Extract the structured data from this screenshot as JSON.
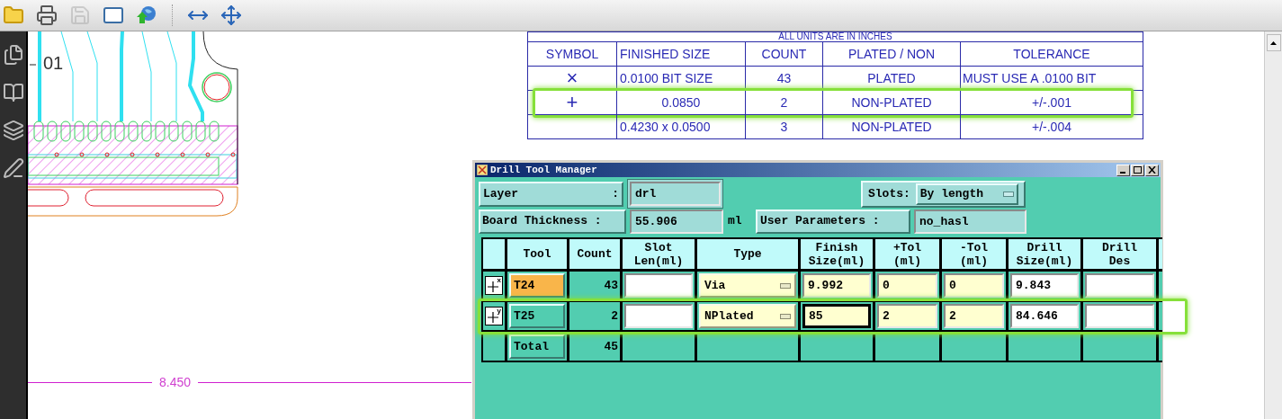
{
  "toolbar": {
    "buttons": [
      {
        "disabled": false
      },
      {
        "disabled": false
      },
      {
        "disabled": true
      },
      {
        "disabled": false
      },
      {
        "disabled": false
      },
      {
        "disabled": false
      },
      {
        "disabled": false
      }
    ]
  },
  "document": {
    "drawing_label": "01",
    "drill_table": {
      "title": "ALL UNITS ARE IN INCHES",
      "columns": [
        "SYMBOL",
        "FINISHED SIZE",
        "COUNT",
        "PLATED / NON",
        "TOLERANCE"
      ],
      "rows": [
        {
          "symbol": "×",
          "finished_size": "0.0100 BIT SIZE",
          "count": "43",
          "plating": "PLATED",
          "tolerance": "MUST USE A .0100 BIT",
          "highlighted": false
        },
        {
          "symbol": "+",
          "finished_size": "0.0850",
          "count": "2",
          "plating": "NON-PLATED",
          "tolerance": "+/-.001",
          "highlighted": true
        },
        {
          "finished_size": "0.4230 x 0.0500",
          "count": "3",
          "plating": "NON-PLATED",
          "tolerance": "+/-.004",
          "highlighted": false
        }
      ]
    },
    "dimension": "8.450"
  },
  "dialog": {
    "title": "Drill Tool Manager",
    "layer": {
      "label": "Layer",
      "colon": ":",
      "value": "drl"
    },
    "slots": {
      "label": "Slots:",
      "value": "By length"
    },
    "board_thickness": {
      "label": "Board Thickness :",
      "value": "55.906",
      "unit": "ml"
    },
    "user_parameters": {
      "label": "User Parameters :",
      "value": "no_hasl"
    },
    "table": {
      "columns": [
        "Tool",
        "Count",
        "Slot Len(ml)",
        "Type",
        "Finish Size(ml)",
        "+Tol (ml)",
        "-Tol (ml)",
        "Drill Size(ml)",
        "Drill Des"
      ],
      "rows": [
        {
          "axis": "x",
          "tool": "T24",
          "selected": true,
          "count": "43",
          "type": "Via",
          "finish_size": "9.992",
          "finish_focused": false,
          "plus_tol": "0",
          "minus_tol": "0",
          "drill_size": "9.843",
          "highlighted": false
        },
        {
          "axis": "y",
          "tool": "T25",
          "selected": false,
          "count": "2",
          "type": "NPlated",
          "finish_size": "85",
          "finish_focused": true,
          "plus_tol": "2",
          "minus_tol": "2",
          "drill_size": "84.646",
          "highlighted": true
        }
      ],
      "total": {
        "label": "Total",
        "count": "45"
      }
    }
  }
}
